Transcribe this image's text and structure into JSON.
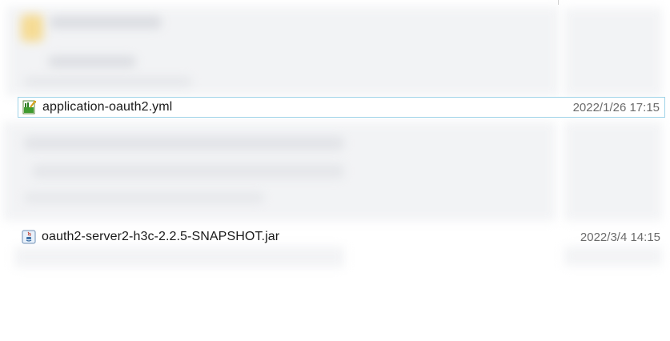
{
  "files": [
    {
      "name": "application-oauth2.yml",
      "date": "2022/1/26 17:15",
      "icon": "yml-file-icon",
      "selected": true
    },
    {
      "name": "oauth2-server2-h3c-2.2.5-SNAPSHOT.jar",
      "date": "2022/3/4 14:15",
      "icon": "java-jar-file-icon",
      "selected": false
    }
  ],
  "colors": {
    "selection_border": "#9fd3e8",
    "date_text": "#6b6b6b"
  }
}
